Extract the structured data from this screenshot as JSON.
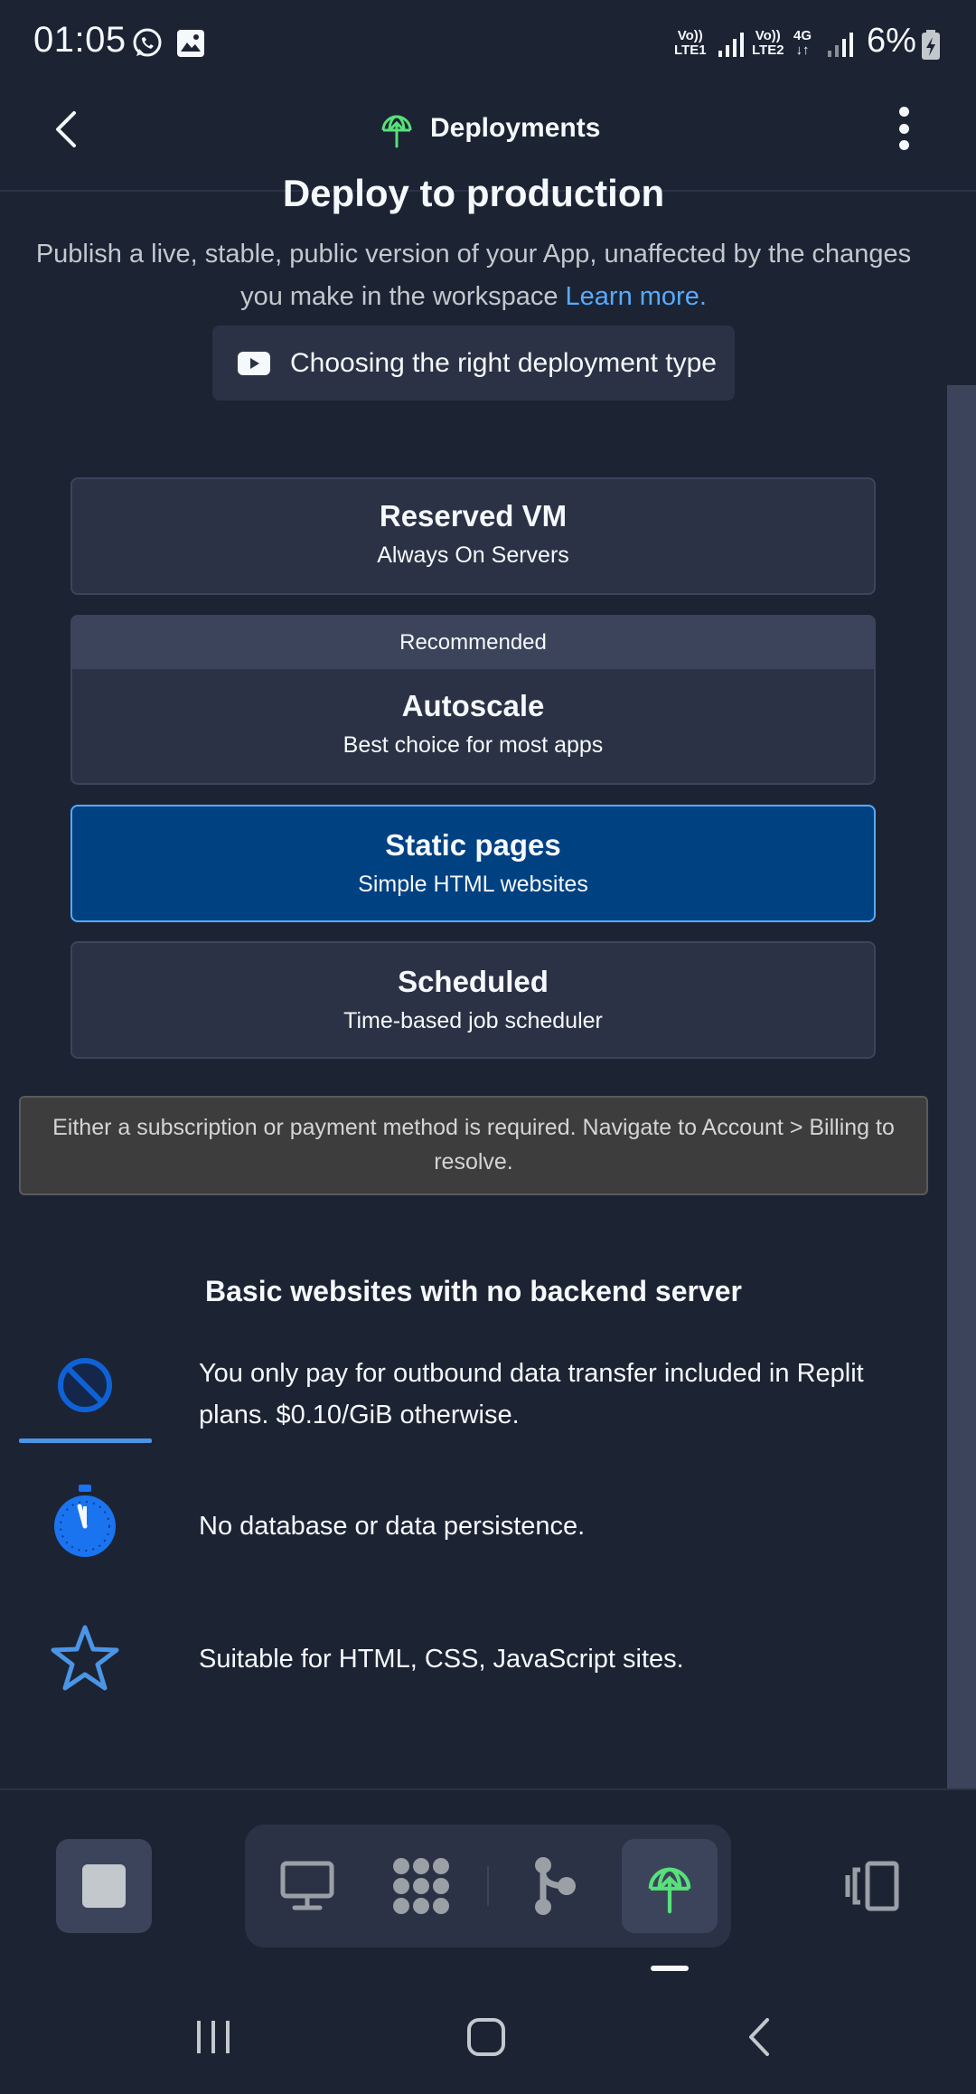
{
  "status_bar": {
    "time": "01:05",
    "sim1_label_top": "Vo))",
    "sim1_label_bottom": "LTE1",
    "sim2_label_top": "Vo))",
    "sim2_label_bottom": "LTE2",
    "network_type": "4G",
    "battery_percent": "6%",
    "icons": [
      "whatsapp-icon",
      "gallery-icon",
      "signal-icon",
      "battery-charging-icon"
    ]
  },
  "app_bar": {
    "title": "Deployments",
    "icons": [
      "back-arrow-icon",
      "deploy-globe-icon",
      "more-vertical-icon"
    ]
  },
  "content": {
    "heading": "Deploy to production",
    "description": "Publish a live, stable, public version of your App, unaffected by the changes you make in the workspace",
    "learn_more": "Learn more.",
    "video_button_label": "Choosing the right deployment type",
    "video_icon": "youtube-icon"
  },
  "deployment_types": [
    {
      "title": "Reserved VM",
      "subtitle": "Always On Servers",
      "badge": "",
      "selected": false
    },
    {
      "title": "Autoscale",
      "subtitle": "Best choice for most apps",
      "badge": "Recommended",
      "selected": false
    },
    {
      "title": "Static pages",
      "subtitle": "Simple HTML websites",
      "badge": "",
      "selected": true
    },
    {
      "title": "Scheduled",
      "subtitle": "Time-based job scheduler",
      "badge": "",
      "selected": false
    }
  ],
  "notice": {
    "text": "Either a subscription or payment method is required. Navigate to Account > Billing to resolve."
  },
  "details": {
    "heading": "Basic websites with no backend server",
    "features": [
      {
        "icon": "prohibited-icon",
        "text": "You only pay for outbound data transfer included in Replit plans. $0.10/GiB otherwise."
      },
      {
        "icon": "stopwatch-icon",
        "text": "No database or data persistence."
      },
      {
        "icon": "star-icon",
        "text": "Suitable for HTML, CSS, JavaScript sites."
      }
    ]
  },
  "toolbar": {
    "items": [
      "stop-icon",
      "webview-monitor-icon",
      "extensions-icon",
      "git-icon",
      "deploy-globe-icon",
      "panels-icon"
    ],
    "active": "deploy-globe-icon"
  },
  "system_nav": {
    "items": [
      "recent-apps-icon",
      "home-icon",
      "back-icon"
    ]
  },
  "colors": {
    "background": "#1c2333",
    "surface": "#2b3245",
    "surface_border": "#3c445c",
    "selected": "#004182",
    "selected_border": "#57abff",
    "accent_link": "#57abff",
    "deploy_green": "#58e07a",
    "notice_background": "#3d3d3d"
  }
}
